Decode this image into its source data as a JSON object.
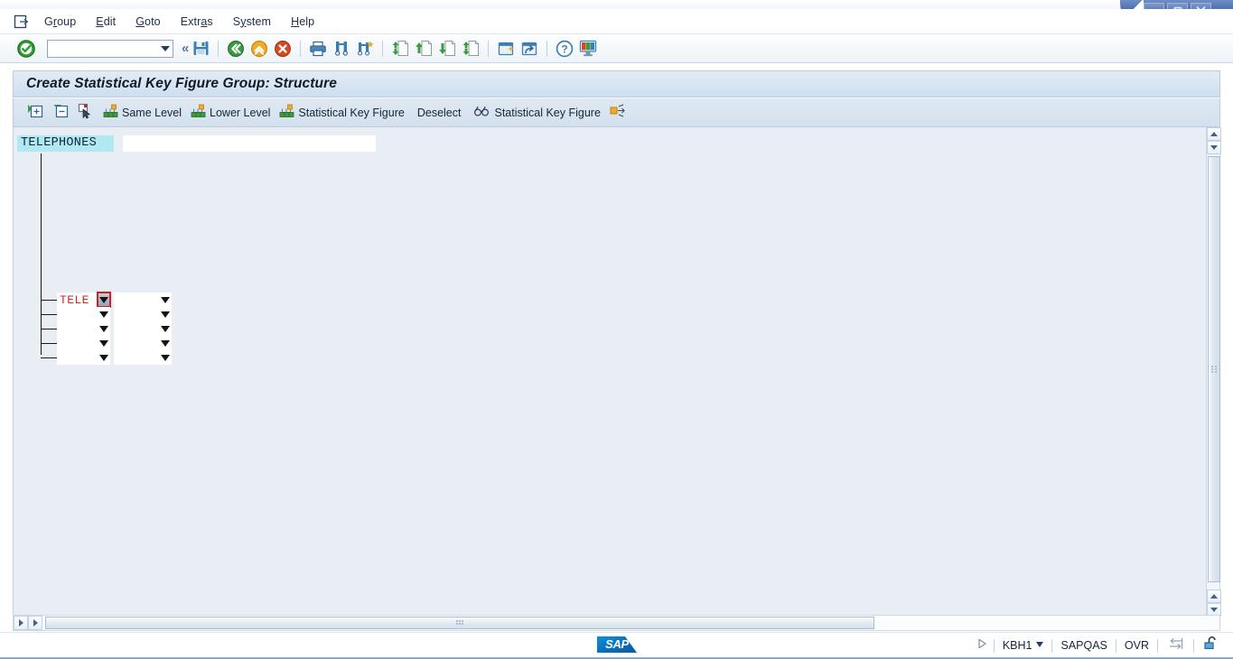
{
  "window": {
    "controls": {
      "minimize": "minimize-button",
      "maximize": "maximize-button",
      "close": "close-button"
    }
  },
  "menubar": {
    "system_icon": "sap-menu-icon",
    "items": [
      {
        "label": "Group",
        "pre": "G",
        "accel": "r",
        "post": "oup"
      },
      {
        "label": "Edit",
        "pre": "",
        "accel": "E",
        "post": "dit"
      },
      {
        "label": "Goto",
        "pre": "",
        "accel": "G",
        "post": "oto"
      },
      {
        "label": "Extras",
        "pre": "Extr",
        "accel": "a",
        "post": "s"
      },
      {
        "label": "System",
        "pre": "S",
        "accel": "y",
        "post": "stem"
      },
      {
        "label": "Help",
        "pre": "",
        "accel": "H",
        "post": "elp"
      }
    ]
  },
  "system_toolbar": {
    "ok_button": "Enter",
    "command_field": {
      "value": "",
      "placeholder": ""
    },
    "buttons": [
      {
        "name": "save-button",
        "tooltip": "Save"
      },
      {
        "name": "back-button",
        "tooltip": "Back"
      },
      {
        "name": "exit-button",
        "tooltip": "Exit"
      },
      {
        "name": "cancel-button",
        "tooltip": "Cancel"
      },
      {
        "name": "print-button",
        "tooltip": "Print"
      },
      {
        "name": "find-button",
        "tooltip": "Find"
      },
      {
        "name": "find-next-button",
        "tooltip": "Find Next"
      },
      {
        "name": "first-page-button",
        "tooltip": "First Page"
      },
      {
        "name": "previous-page-button",
        "tooltip": "Previous Page"
      },
      {
        "name": "next-page-button",
        "tooltip": "Next Page"
      },
      {
        "name": "last-page-button",
        "tooltip": "Last Page"
      },
      {
        "name": "create-session-button",
        "tooltip": "Create New Session"
      },
      {
        "name": "create-shortcut-button",
        "tooltip": "Create Shortcut"
      },
      {
        "name": "help-button",
        "tooltip": "Help"
      },
      {
        "name": "layout-menu-button",
        "tooltip": "Customize Local Layout"
      }
    ]
  },
  "page": {
    "title": "Create Statistical Key Figure Group: Structure"
  },
  "app_toolbar": {
    "buttons": [
      {
        "name": "expand-subtree-button",
        "label": "",
        "icon": "expand-node-icon"
      },
      {
        "name": "collapse-subtree-button",
        "label": "",
        "icon": "collapse-node-icon"
      },
      {
        "name": "select-block-button",
        "label": "",
        "icon": "pointer-select-icon"
      },
      {
        "name": "same-level-button",
        "label": "Same Level",
        "icon": "hierarchy-same-level-icon"
      },
      {
        "name": "lower-level-button",
        "label": "Lower Level",
        "icon": "hierarchy-lower-level-icon"
      },
      {
        "name": "insert-statistical-key-figure-button",
        "label": "Statistical Key Figure",
        "icon": "hierarchy-node-icon"
      },
      {
        "name": "deselect-button",
        "label": "Deselect",
        "icon": ""
      },
      {
        "name": "find-statistical-key-figure-button",
        "label": "Statistical Key Figure",
        "icon": "glasses-icon"
      },
      {
        "name": "expand-all-button",
        "label": "",
        "icon": "expand-arrows-icon"
      }
    ]
  },
  "tree": {
    "root": {
      "label": "TELEPHONES",
      "description": "",
      "description_placeholder": ""
    },
    "children": [
      {
        "value": "TELE",
        "value2": "",
        "focused": true
      },
      {
        "value": "",
        "value2": "",
        "focused": false
      },
      {
        "value": "",
        "value2": "",
        "focused": false
      },
      {
        "value": "",
        "value2": "",
        "focused": false
      },
      {
        "value": "",
        "value2": "",
        "focused": false
      }
    ]
  },
  "scrollbars": {
    "vertical": {
      "up_top": "scroll-up",
      "down_top": "scroll-down",
      "up_bottom": "scroll-up",
      "down_bottom": "scroll-down"
    },
    "horizontal": {
      "left": "scroll-left",
      "right": "scroll-right"
    }
  },
  "status_bar": {
    "logo": "SAP",
    "session_indicator": "session-play-icon",
    "system_id": "KBH1",
    "server": "SAPQAS",
    "insert_mode": "OVR",
    "transfer_icon": "data-transfer-icon",
    "lock_icon": "lock-open-icon"
  },
  "colors": {
    "title_bar_gradient_start": "#e3ecf5",
    "title_bar_gradient_end": "#cfdeee",
    "canvas_background": "#e9eef5",
    "root_node_highlight": "#b2e8f2",
    "focused_field_border": "#d02020",
    "entry_text": "#cc2a2a",
    "sap_blue": "#0a6fb8"
  }
}
